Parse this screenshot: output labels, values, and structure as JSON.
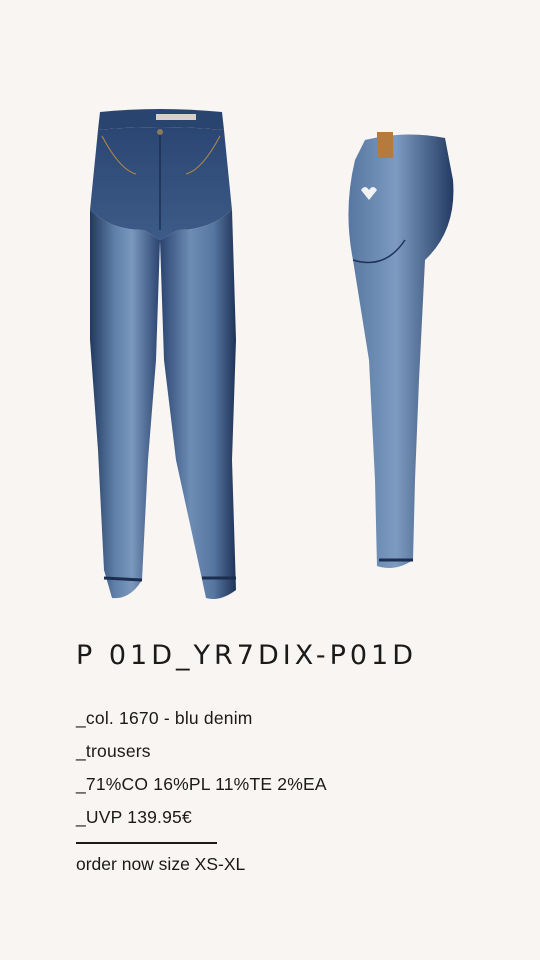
{
  "product": {
    "title": "P 01D_YR7DIX-P01D",
    "details": [
      "_col. 1670 - blu denim",
      "_trousers",
      "_71%CO 16%PL 11%TE 2%EA",
      "_UVP 139.95€"
    ],
    "order_label": "order now size XS-XL",
    "denim_color": "#2f4c7a",
    "denim_light": "#6f8fb5",
    "denim_dark": "#1f3358",
    "background": "#f8f5f3"
  }
}
